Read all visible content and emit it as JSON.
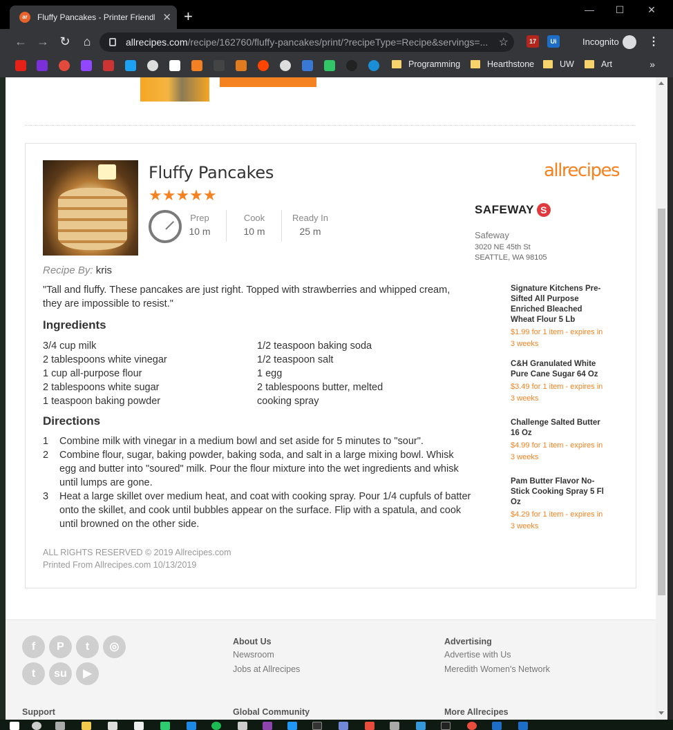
{
  "browser": {
    "tab_title": "Fluffy Pancakes - Printer Friendly",
    "url_host": "allrecipes.com",
    "url_path": "/recipe/162760/fluffy-pancakes/print/?recipeType=Recipe&servings=...",
    "incognito_label": "Incognito",
    "ext_badge": "17",
    "bookmark_folders": [
      "Programming",
      "Hearthstone",
      "UW",
      "Art"
    ]
  },
  "recipe": {
    "title": "Fluffy Pancakes",
    "rating_stars": "★★★★★",
    "prep_label": "Prep",
    "prep_value": "10 m",
    "cook_label": "Cook",
    "cook_value": "10 m",
    "ready_label": "Ready In",
    "ready_value": "25 m",
    "byline_label": "Recipe By:",
    "author": "kris",
    "description": "\"Tall and fluffy. These pancakes are just right. Topped with strawberries and whipped cream, they are impossible to resist.\"",
    "ingredients_heading": "Ingredients",
    "ingredients_left": [
      "3/4 cup milk",
      "2 tablespoons white vinegar",
      "1 cup all-purpose flour",
      "2 tablespoons white sugar",
      "1 teaspoon baking powder"
    ],
    "ingredients_right": [
      "1/2 teaspoon baking soda",
      "1/2 teaspoon salt",
      "1 egg",
      "2 tablespoons butter, melted",
      "cooking spray"
    ],
    "directions_heading": "Directions",
    "directions": [
      {
        "num": "1",
        "text": "Combine milk with vinegar in a medium bowl and set aside for 5 minutes to \"sour\"."
      },
      {
        "num": "2",
        "text": "Combine flour, sugar, baking powder, baking soda, and salt in a large mixing bowl. Whisk egg and butter into \"soured\" milk. Pour the flour mixture into the wet ingredients and whisk until lumps are gone."
      },
      {
        "num": "3",
        "text": "Heat a large skillet over medium heat, and coat with cooking spray. Pour 1/4 cupfuls of batter onto the skillet, and cook until bubbles appear on the surface. Flip with a spatula, and cook until browned on the other side."
      }
    ],
    "rights": "ALL RIGHTS RESERVED © 2019 Allrecipes.com",
    "printed": "Printed From Allrecipes.com 10/13/2019"
  },
  "brand": {
    "logo": "allrecipes",
    "accent": "#f58220"
  },
  "store": {
    "logo": "SAFEWAY",
    "name": "Safeway",
    "address1": "3020 NE 45th St",
    "address2": "SEATTLE, WA 98105"
  },
  "deals": [
    {
      "name": "Signature Kitchens Pre-Sifted All Purpose Enriched Bleached Wheat Flour 5 Lb",
      "price": "$1.99 for 1 item - expires in 3 weeks"
    },
    {
      "name": "C&H Granulated White Pure Cane Sugar 64 Oz",
      "price": "$3.49 for 1 item - expires in 3 weeks"
    },
    {
      "name": "Challenge Salted Butter 16 Oz",
      "price": "$4.99 for 1 item - expires in 3 weeks"
    },
    {
      "name": "Pam Butter Flavor No-Stick Cooking Spray 5 Fl Oz",
      "price": "$4.29 for 1 item - expires in 3 weeks"
    }
  ],
  "site_footer": {
    "col1_heading": "About Us",
    "col1_links": [
      "Newsroom",
      "Jobs at Allrecipes"
    ],
    "col2_heading": "Advertising",
    "col2_links": [
      "Advertise with Us",
      "Meredith Women's Network"
    ],
    "bottom_headings": [
      "Support",
      "Global Community",
      "More Allrecipes"
    ],
    "social_icons": [
      "facebook-icon",
      "pinterest-icon",
      "twitter-icon",
      "instagram-icon",
      "tumblr-icon",
      "stumbleupon-icon",
      "youtube-icon"
    ]
  }
}
